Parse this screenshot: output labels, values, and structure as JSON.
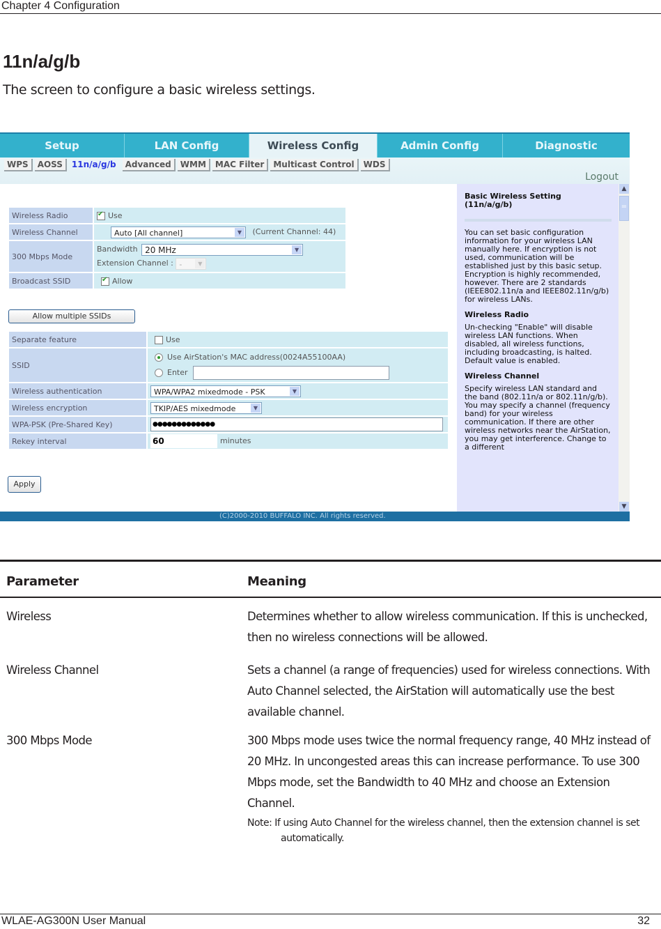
{
  "chapter": "Chapter 4  Configuration",
  "section": {
    "title": "11n/a/g/b",
    "description": "The screen to configure a basic wireless settings."
  },
  "screenshot": {
    "top_tabs": [
      {
        "label": "Setup",
        "active": false
      },
      {
        "label": "LAN Config",
        "active": false
      },
      {
        "label": "Wireless Config",
        "active": true
      },
      {
        "label": "Admin Config",
        "active": false
      },
      {
        "label": "Diagnostic",
        "active": false
      }
    ],
    "sub_tabs": [
      {
        "label": "WPS",
        "active": false
      },
      {
        "label": "AOSS",
        "active": false
      },
      {
        "label": "11n/a/g/b",
        "active": true
      },
      {
        "label": "Advanced",
        "active": false
      },
      {
        "label": "WMM",
        "active": false
      },
      {
        "label": "MAC Filter",
        "active": false
      },
      {
        "label": "Multicast Control",
        "active": false
      },
      {
        "label": "WDS",
        "active": false
      }
    ],
    "logout": "Logout",
    "form1": {
      "wireless_radio": {
        "label": "Wireless Radio",
        "checkbox_label": "Use",
        "checked": true
      },
      "wireless_channel": {
        "label": "Wireless Channel",
        "value": "Auto [All channel]",
        "current": "(Current Channel: 44)"
      },
      "mode_300": {
        "label": "300 Mbps Mode",
        "bandwidth_label": "Bandwidth",
        "bandwidth_value": "20 MHz",
        "extension_label": "Extension Channel :",
        "extension_value": "-"
      },
      "broadcast_ssid": {
        "label": "Broadcast SSID",
        "checkbox_label": "Allow",
        "checked": true
      }
    },
    "multi_ssid_button": "Allow multiple SSIDs",
    "form2": {
      "separate_feature": {
        "label": "Separate feature",
        "checkbox_label": "Use",
        "checked": false
      },
      "ssid": {
        "label": "SSID",
        "option_mac": "Use AirStation's MAC address(0024A55100AA)",
        "option_enter": "Enter",
        "enter_value": "",
        "selected": "mac"
      },
      "authentication": {
        "label": "Wireless authentication",
        "value": "WPA/WPA2 mixedmode - PSK"
      },
      "encryption": {
        "label": "Wireless encryption",
        "value": "TKIP/AES mixedmode"
      },
      "psk": {
        "label": "WPA-PSK (Pre-Shared Key)",
        "value": "●●●●●●●●●●●●●"
      },
      "rekey": {
        "label": "Rekey interval",
        "value": "60",
        "unit": "minutes"
      }
    },
    "apply_button": "Apply",
    "help": {
      "title": "Basic Wireless Setting (11n/a/g/b)",
      "intro": "You can set basic configuration information for your wireless LAN manually here. If encryption is not used, communication will be established just by this basic setup. Encryption is highly recommended, however. There are 2 standards (IEEE802.11n/a and IEEE802.11n/g/b) for wireless LANs.",
      "radio_title": "Wireless Radio",
      "radio_text": "Un-checking \"Enable\" will disable wireless LAN functions. When disabled, all wireless functions, including broadcasting, is halted. Default value is enabled.",
      "channel_title": "Wireless Channel",
      "channel_text": "Specify wireless LAN standard and the band (802.11n/a or 802.11n/g/b). You may specify a channel (frequency band) for your wireless communication. If there are other wireless networks near the AirStation, you may get interference. Change to a different"
    },
    "copyright": "(C)2000-2010 BUFFALO INC. All rights reserved."
  },
  "param_table": {
    "headers": [
      "Parameter",
      "Meaning"
    ],
    "rows": [
      {
        "parameter": "Wireless",
        "meaning": "Determines whether to allow wireless communication. If this is unchecked, then no wireless connections will be allowed."
      },
      {
        "parameter": "Wireless Channel",
        "meaning": "Sets a channel (a range of frequencies) used for wireless connections. With Auto Channel selected, the AirStation will automatically use the best available channel."
      },
      {
        "parameter": "300 Mbps Mode",
        "meaning": "300 Mbps mode uses twice the normal frequency range, 40 MHz instead of 20 MHz.  In uncongested areas this can increase performance. To use 300 Mbps mode, set the Bandwidth to 40 MHz and choose an Extension Channel.",
        "note": "Note: If using Auto Channel for the wireless channel, then the extension channel is set automatically."
      }
    ]
  },
  "footer": {
    "manual": "WLAE-AG300N User Manual",
    "page": "32"
  }
}
